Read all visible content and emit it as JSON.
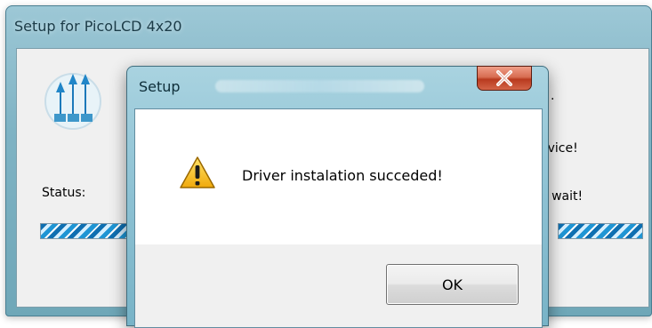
{
  "background_window": {
    "title": "Setup for PicoLCD 4x20",
    "status_label": "Status:",
    "right_text_top": ".",
    "right_text_1": "evice!",
    "right_text_2": "e wait!"
  },
  "dialog": {
    "title": "Setup",
    "close_symbol": "X",
    "message": "Driver instalation succeded!",
    "ok_label": "OK"
  },
  "icons": {
    "app": "picolcd-app-icon",
    "warning": "warning-icon",
    "close": "close-icon"
  },
  "colors": {
    "title_bar": "#8dc1d3",
    "close_button": "#c94b2d",
    "progress": "#1f95d4",
    "warning": "#f7c52f"
  }
}
